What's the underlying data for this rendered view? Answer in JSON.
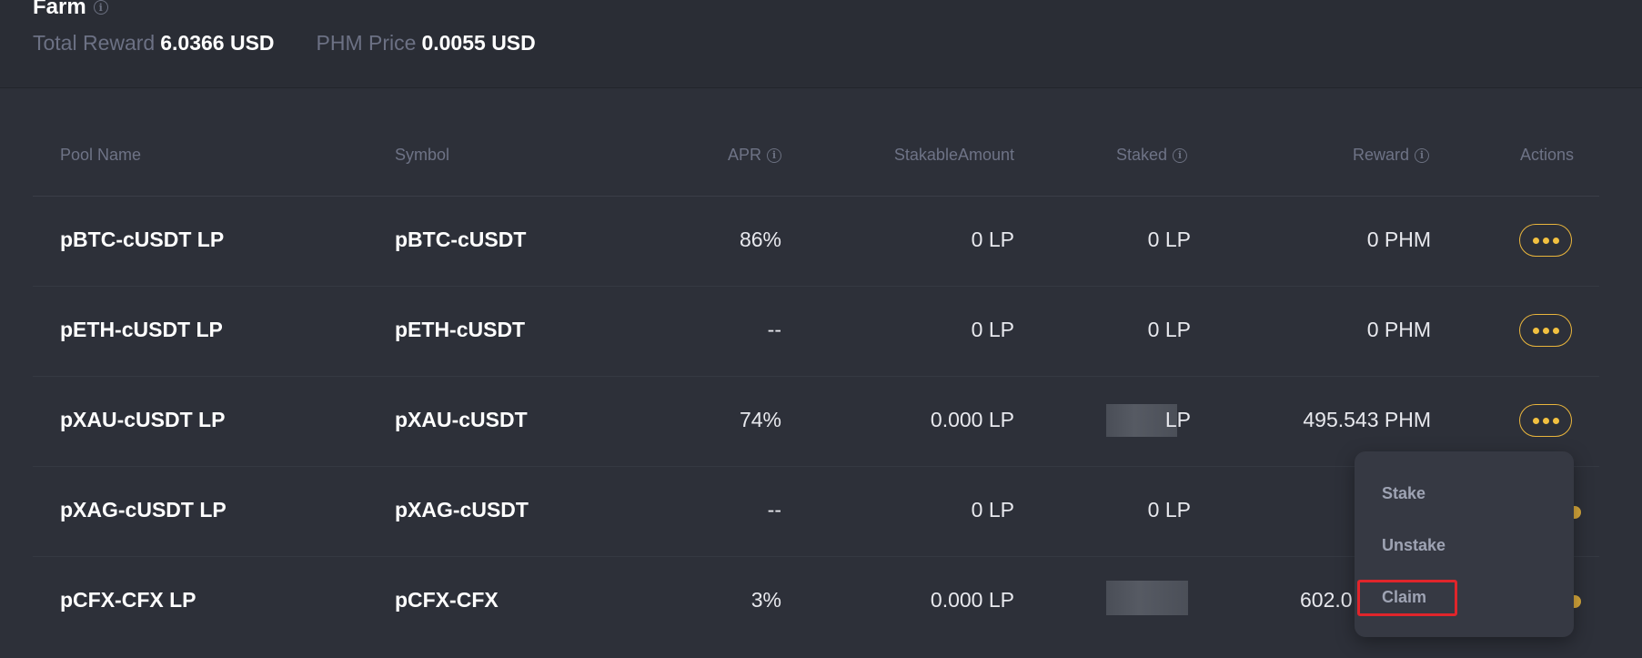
{
  "header": {
    "title": "Farm",
    "total_reward_label": "Total Reward",
    "total_reward_value": "6.0366 USD",
    "price_label": "PHM Price",
    "price_value": "0.0055 USD"
  },
  "table": {
    "columns": {
      "pool_name": "Pool Name",
      "symbol": "Symbol",
      "apr": "APR",
      "stakable": "StakableAmount",
      "staked": "Staked",
      "reward": "Reward",
      "actions": "Actions"
    },
    "rows": [
      {
        "pool_name": "pBTC-cUSDT LP",
        "symbol": "pBTC-cUSDT",
        "apr": "86%",
        "stakable": "0 LP",
        "staked": "0 LP",
        "reward": "0 PHM"
      },
      {
        "pool_name": "pETH-cUSDT LP",
        "symbol": "pETH-cUSDT",
        "apr": "--",
        "stakable": "0 LP",
        "staked": "0 LP",
        "reward": "0 PHM"
      },
      {
        "pool_name": "pXAU-cUSDT LP",
        "symbol": "pXAU-cUSDT",
        "apr": "74%",
        "stakable": "0.000 LP",
        "staked": "LP",
        "reward": "495.543 PHM"
      },
      {
        "pool_name": "pXAG-cUSDT LP",
        "symbol": "pXAG-cUSDT",
        "apr": "--",
        "stakable": "0 LP",
        "staked": "0 LP",
        "reward": ""
      },
      {
        "pool_name": "pCFX-CFX LP",
        "symbol": "pCFX-CFX",
        "apr": "3%",
        "stakable": "0.000 LP",
        "staked": "",
        "reward": "602.0"
      }
    ]
  },
  "dropdown": {
    "items": [
      "Stake",
      "Unstake",
      "Claim"
    ]
  },
  "colors": {
    "accent": "#f1c040",
    "highlight": "#e0252b",
    "background": "#2d3039"
  }
}
